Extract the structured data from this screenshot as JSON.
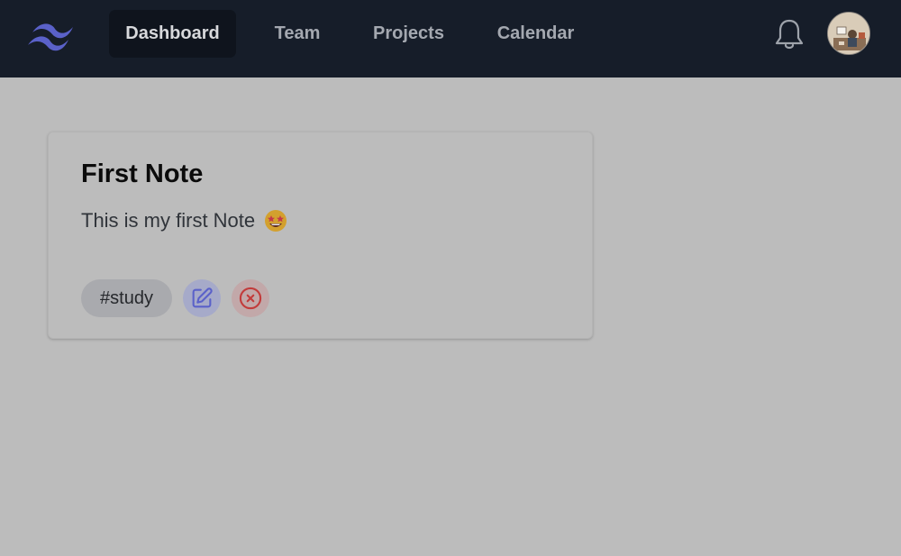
{
  "nav": {
    "items": [
      {
        "label": "Dashboard",
        "active": true
      },
      {
        "label": "Team",
        "active": false
      },
      {
        "label": "Projects",
        "active": false
      },
      {
        "label": "Calendar",
        "active": false
      }
    ],
    "logo_icon": "tailwind-logo-icon",
    "notification_icon": "bell-icon",
    "avatar_icon": "user-avatar"
  },
  "note": {
    "title": "First Note",
    "body": "This is my first Note",
    "emoji": "star-struck-emoji",
    "tag": "#study",
    "edit_icon": "edit-icon",
    "delete_icon": "close-circle-icon"
  },
  "colors": {
    "navbar": "#161d29",
    "background": "#bcbcbc",
    "accent": "#5a61c9",
    "danger": "#c23b3b"
  }
}
